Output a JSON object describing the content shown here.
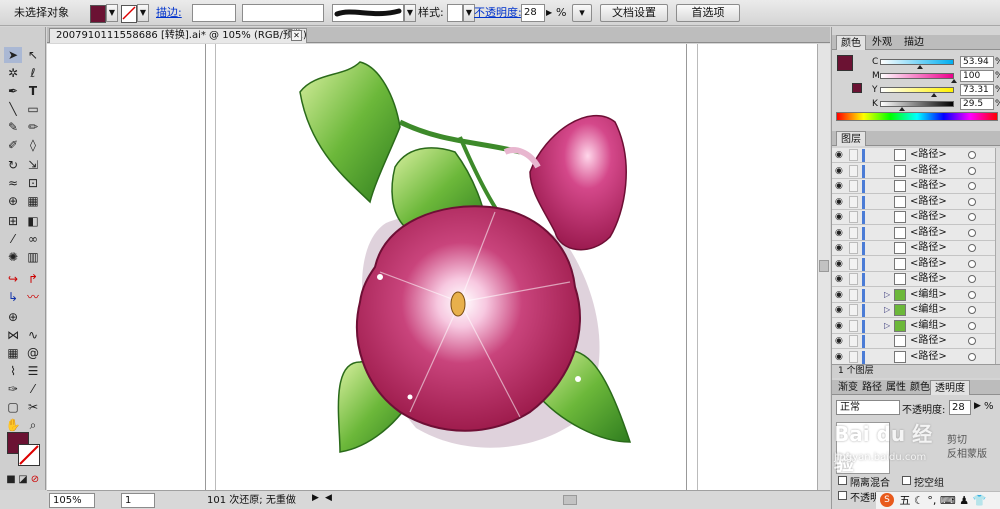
{
  "topbar": {
    "selection_status": "未选择对象",
    "fill_color": "#6b1233",
    "stroke_label": "描边:",
    "style_label": "样式:",
    "opacity_label": "不透明度:",
    "opacity_value": "28",
    "opacity_unit": "%",
    "doc_settings_button": "文档设置",
    "preferences_button": "首选项"
  },
  "document": {
    "tab_title": "2007910111558686  [转换].ai* @ 105% (RGB/预览)",
    "close_label": "✕"
  },
  "statusbar": {
    "zoom": "105%",
    "artboard": "1",
    "status_text": "101 次还原; 无重做"
  },
  "color_panel": {
    "tabs": [
      "颜色",
      "外观",
      "描边"
    ],
    "fill_color": "#6b1233",
    "channels": [
      {
        "key": "C",
        "value": "53.94",
        "fraction": 0.54
      },
      {
        "key": "M",
        "value": "100",
        "fraction": 1.0
      },
      {
        "key": "Y",
        "value": "73.31",
        "fraction": 0.73
      },
      {
        "key": "K",
        "value": "29.5",
        "fraction": 0.295
      }
    ],
    "unit": "%"
  },
  "layers_panel": {
    "title": "图层",
    "rows": [
      {
        "name": "<路径>",
        "group": false
      },
      {
        "name": "<路径>",
        "group": false
      },
      {
        "name": "<路径>",
        "group": false
      },
      {
        "name": "<路径>",
        "group": false
      },
      {
        "name": "<路径>",
        "group": false
      },
      {
        "name": "<路径>",
        "group": false
      },
      {
        "name": "<路径>",
        "group": false
      },
      {
        "name": "<路径>",
        "group": false
      },
      {
        "name": "<路径>",
        "group": false
      },
      {
        "name": "<编组>",
        "group": true
      },
      {
        "name": "<编组>",
        "group": true
      },
      {
        "name": "<编组>",
        "group": true
      },
      {
        "name": "<路径>",
        "group": false
      },
      {
        "name": "<路径>",
        "group": false
      }
    ],
    "footer": "1 个图层"
  },
  "transparency_panel": {
    "tabs": [
      "渐变",
      "路径",
      "属性",
      "颜色",
      "透明度"
    ],
    "blend_mode": "正常",
    "opacity_label": "不透明度:",
    "opacity_value": "28",
    "unit": "%",
    "clip_label": "剪切",
    "invert_mask_label": "反相蒙版",
    "isolate_blending": "隔离混合",
    "knockout_group": "挖空组",
    "opacity_mask": "不透明"
  },
  "watermark": {
    "brand": "Bai du 经验",
    "url": "jingyan.baidu.com"
  },
  "ime_bar": {
    "label": "五"
  }
}
